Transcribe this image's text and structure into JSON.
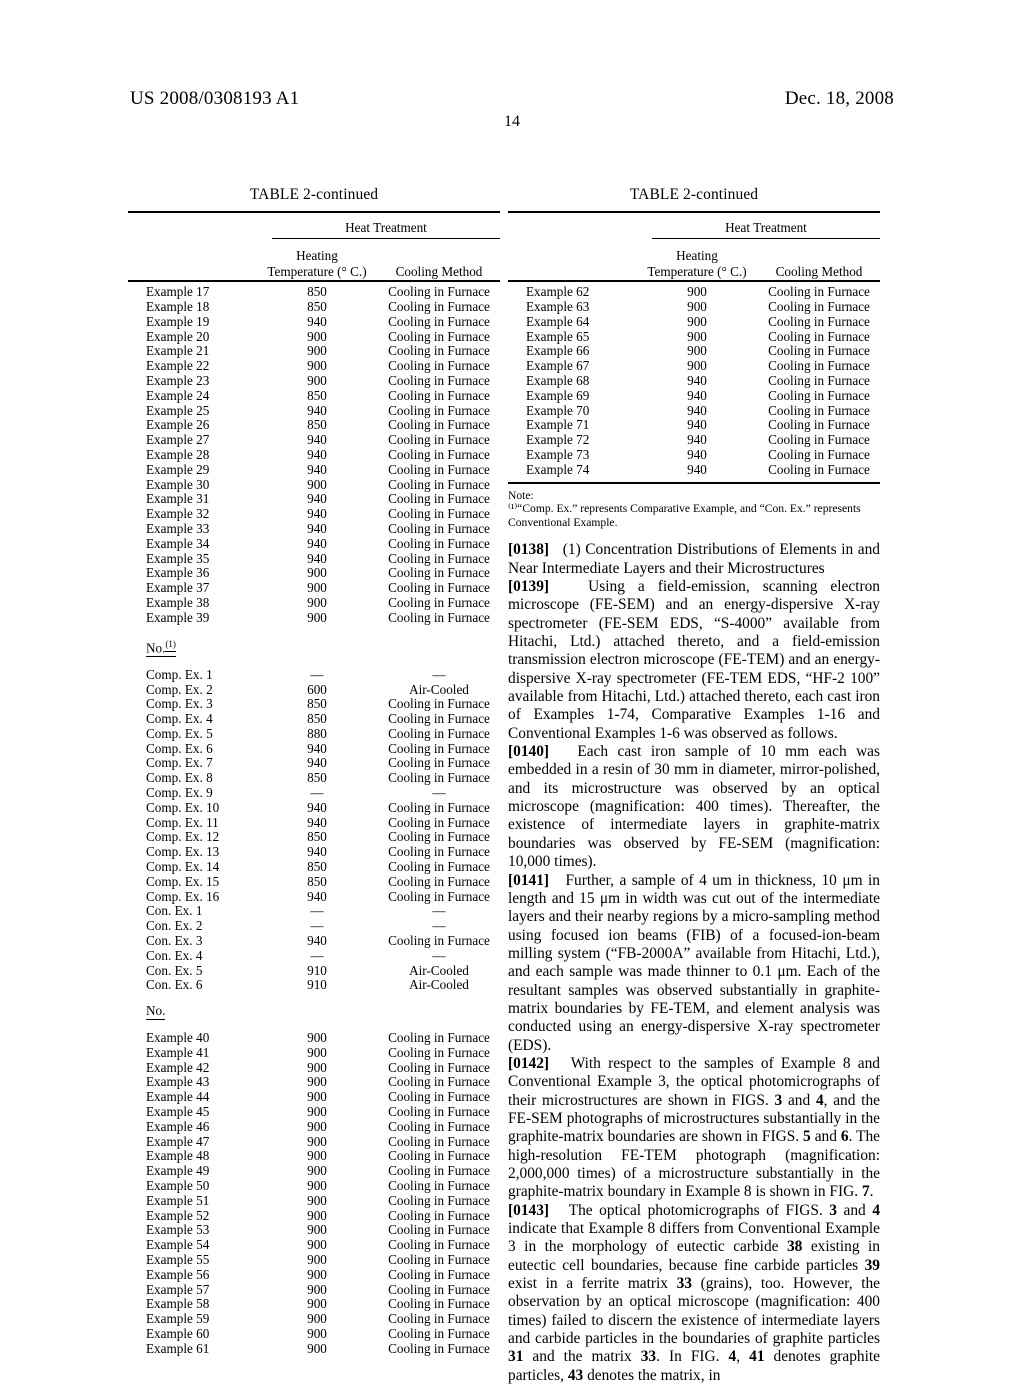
{
  "header": {
    "publication_number": "US 2008/0308193 A1",
    "date": "Dec. 18, 2008",
    "page_number": "14"
  },
  "tables": [
    {
      "title": "TABLE 2-continued",
      "span_header": "Heat Treatment",
      "columns": {
        "name": "",
        "temperature_line1": "Heating",
        "temperature_line2": "Temperature (° C.)",
        "cooling": "Cooling Method"
      },
      "groups": [
        {
          "subheader": null,
          "rows": [
            {
              "name": "Example 17",
              "temperature": "850",
              "cooling": "Cooling in Furnace"
            },
            {
              "name": "Example 18",
              "temperature": "850",
              "cooling": "Cooling in Furnace"
            },
            {
              "name": "Example 19",
              "temperature": "940",
              "cooling": "Cooling in Furnace"
            },
            {
              "name": "Example 20",
              "temperature": "900",
              "cooling": "Cooling in Furnace"
            },
            {
              "name": "Example 21",
              "temperature": "900",
              "cooling": "Cooling in Furnace"
            },
            {
              "name": "Example 22",
              "temperature": "900",
              "cooling": "Cooling in Furnace"
            },
            {
              "name": "Example 23",
              "temperature": "900",
              "cooling": "Cooling in Furnace"
            },
            {
              "name": "Example 24",
              "temperature": "850",
              "cooling": "Cooling in Furnace"
            },
            {
              "name": "Example 25",
              "temperature": "940",
              "cooling": "Cooling in Furnace"
            },
            {
              "name": "Example 26",
              "temperature": "850",
              "cooling": "Cooling in Furnace"
            },
            {
              "name": "Example 27",
              "temperature": "940",
              "cooling": "Cooling in Furnace"
            },
            {
              "name": "Example 28",
              "temperature": "940",
              "cooling": "Cooling in Furnace"
            },
            {
              "name": "Example 29",
              "temperature": "940",
              "cooling": "Cooling in Furnace"
            },
            {
              "name": "Example 30",
              "temperature": "900",
              "cooling": "Cooling in Furnace"
            },
            {
              "name": "Example 31",
              "temperature": "940",
              "cooling": "Cooling in Furnace"
            },
            {
              "name": "Example 32",
              "temperature": "940",
              "cooling": "Cooling in Furnace"
            },
            {
              "name": "Example 33",
              "temperature": "940",
              "cooling": "Cooling in Furnace"
            },
            {
              "name": "Example 34",
              "temperature": "940",
              "cooling": "Cooling in Furnace"
            },
            {
              "name": "Example 35",
              "temperature": "940",
              "cooling": "Cooling in Furnace"
            },
            {
              "name": "Example 36",
              "temperature": "900",
              "cooling": "Cooling in Furnace"
            },
            {
              "name": "Example 37",
              "temperature": "900",
              "cooling": "Cooling in Furnace"
            },
            {
              "name": "Example 38",
              "temperature": "900",
              "cooling": "Cooling in Furnace"
            },
            {
              "name": "Example 39",
              "temperature": "900",
              "cooling": "Cooling in Furnace"
            }
          ]
        },
        {
          "subheader": "No.",
          "subheader_sup": "(1)",
          "rows": [
            {
              "name": "Comp. Ex. 1",
              "temperature": "—",
              "cooling": "—"
            },
            {
              "name": "Comp. Ex. 2",
              "temperature": "600",
              "cooling": "Air-Cooled"
            },
            {
              "name": "Comp. Ex. 3",
              "temperature": "850",
              "cooling": "Cooling in Furnace"
            },
            {
              "name": "Comp. Ex. 4",
              "temperature": "850",
              "cooling": "Cooling in Furnace"
            },
            {
              "name": "Comp. Ex. 5",
              "temperature": "880",
              "cooling": "Cooling in Furnace"
            },
            {
              "name": "Comp. Ex. 6",
              "temperature": "940",
              "cooling": "Cooling in Furnace"
            },
            {
              "name": "Comp. Ex. 7",
              "temperature": "940",
              "cooling": "Cooling in Furnace"
            },
            {
              "name": "Comp. Ex. 8",
              "temperature": "850",
              "cooling": "Cooling in Furnace"
            },
            {
              "name": "Comp. Ex. 9",
              "temperature": "—",
              "cooling": "—"
            },
            {
              "name": "Comp. Ex. 10",
              "temperature": "940",
              "cooling": "Cooling in Furnace"
            },
            {
              "name": "Comp. Ex. 11",
              "temperature": "940",
              "cooling": "Cooling in Furnace"
            },
            {
              "name": "Comp. Ex. 12",
              "temperature": "850",
              "cooling": "Cooling in Furnace"
            },
            {
              "name": "Comp. Ex. 13",
              "temperature": "940",
              "cooling": "Cooling in Furnace"
            },
            {
              "name": "Comp. Ex. 14",
              "temperature": "850",
              "cooling": "Cooling in Furnace"
            },
            {
              "name": "Comp. Ex. 15",
              "temperature": "850",
              "cooling": "Cooling in Furnace"
            },
            {
              "name": "Comp. Ex. 16",
              "temperature": "940",
              "cooling": "Cooling in Furnace"
            },
            {
              "name": "Con. Ex. 1",
              "temperature": "—",
              "cooling": "—"
            },
            {
              "name": "Con. Ex. 2",
              "temperature": "—",
              "cooling": "—"
            },
            {
              "name": "Con. Ex. 3",
              "temperature": "940",
              "cooling": "Cooling in Furnace"
            },
            {
              "name": "Con. Ex. 4",
              "temperature": "—",
              "cooling": "—"
            },
            {
              "name": "Con. Ex. 5",
              "temperature": "910",
              "cooling": "Air-Cooled"
            },
            {
              "name": "Con. Ex. 6",
              "temperature": "910",
              "cooling": "Air-Cooled"
            }
          ]
        },
        {
          "subheader": "No.",
          "subheader_sup": "",
          "rows": [
            {
              "name": "Example 40",
              "temperature": "900",
              "cooling": "Cooling in Furnace"
            },
            {
              "name": "Example 41",
              "temperature": "900",
              "cooling": "Cooling in Furnace"
            },
            {
              "name": "Example 42",
              "temperature": "900",
              "cooling": "Cooling in Furnace"
            },
            {
              "name": "Example 43",
              "temperature": "900",
              "cooling": "Cooling in Furnace"
            },
            {
              "name": "Example 44",
              "temperature": "900",
              "cooling": "Cooling in Furnace"
            },
            {
              "name": "Example 45",
              "temperature": "900",
              "cooling": "Cooling in Furnace"
            },
            {
              "name": "Example 46",
              "temperature": "900",
              "cooling": "Cooling in Furnace"
            },
            {
              "name": "Example 47",
              "temperature": "900",
              "cooling": "Cooling in Furnace"
            },
            {
              "name": "Example 48",
              "temperature": "900",
              "cooling": "Cooling in Furnace"
            },
            {
              "name": "Example 49",
              "temperature": "900",
              "cooling": "Cooling in Furnace"
            },
            {
              "name": "Example 50",
              "temperature": "900",
              "cooling": "Cooling in Furnace"
            },
            {
              "name": "Example 51",
              "temperature": "900",
              "cooling": "Cooling in Furnace"
            },
            {
              "name": "Example 52",
              "temperature": "900",
              "cooling": "Cooling in Furnace"
            },
            {
              "name": "Example 53",
              "temperature": "900",
              "cooling": "Cooling in Furnace"
            },
            {
              "name": "Example 54",
              "temperature": "900",
              "cooling": "Cooling in Furnace"
            },
            {
              "name": "Example 55",
              "temperature": "900",
              "cooling": "Cooling in Furnace"
            },
            {
              "name": "Example 56",
              "temperature": "900",
              "cooling": "Cooling in Furnace"
            },
            {
              "name": "Example 57",
              "temperature": "900",
              "cooling": "Cooling in Furnace"
            },
            {
              "name": "Example 58",
              "temperature": "900",
              "cooling": "Cooling in Furnace"
            },
            {
              "name": "Example 59",
              "temperature": "900",
              "cooling": "Cooling in Furnace"
            },
            {
              "name": "Example 60",
              "temperature": "900",
              "cooling": "Cooling in Furnace"
            },
            {
              "name": "Example 61",
              "temperature": "900",
              "cooling": "Cooling in Furnace"
            }
          ]
        }
      ]
    },
    {
      "title": "TABLE 2-continued",
      "span_header": "Heat Treatment",
      "columns": {
        "name": "",
        "temperature_line1": "Heating",
        "temperature_line2": "Temperature (° C.)",
        "cooling": "Cooling Method"
      },
      "groups": [
        {
          "subheader": null,
          "rows": [
            {
              "name": "Example 62",
              "temperature": "900",
              "cooling": "Cooling in Furnace"
            },
            {
              "name": "Example 63",
              "temperature": "900",
              "cooling": "Cooling in Furnace"
            },
            {
              "name": "Example 64",
              "temperature": "900",
              "cooling": "Cooling in Furnace"
            },
            {
              "name": "Example 65",
              "temperature": "900",
              "cooling": "Cooling in Furnace"
            },
            {
              "name": "Example 66",
              "temperature": "900",
              "cooling": "Cooling in Furnace"
            },
            {
              "name": "Example 67",
              "temperature": "900",
              "cooling": "Cooling in Furnace"
            },
            {
              "name": "Example 68",
              "temperature": "940",
              "cooling": "Cooling in Furnace"
            },
            {
              "name": "Example 69",
              "temperature": "940",
              "cooling": "Cooling in Furnace"
            },
            {
              "name": "Example 70",
              "temperature": "940",
              "cooling": "Cooling in Furnace"
            },
            {
              "name": "Example 71",
              "temperature": "940",
              "cooling": "Cooling in Furnace"
            },
            {
              "name": "Example 72",
              "temperature": "940",
              "cooling": "Cooling in Furnace"
            },
            {
              "name": "Example 73",
              "temperature": "940",
              "cooling": "Cooling in Furnace"
            },
            {
              "name": "Example 74",
              "temperature": "940",
              "cooling": "Cooling in Furnace"
            }
          ]
        }
      ]
    }
  ],
  "note": {
    "label": "Note:",
    "text": "⁽¹⁾“Comp. Ex.” represents Comparative Example, and “Con. Ex.” represents Conventional Example."
  },
  "paragraphs": [
    {
      "number": "[0138]",
      "text": "(1) Concentration Distributions of Elements in and Near Intermediate Layers and their Microstructures"
    },
    {
      "number": "[0139]",
      "text": "Using a field-emission, scanning electron microscope (FE-SEM) and an energy-dispersive X-ray spectrometer (FE-SEM EDS, “S-4000” available from Hitachi, Ltd.) attached thereto, and a field-emission transmission electron microscope (FE-TEM) and an energy-dispersive X-ray spectrometer (FE-TEM EDS, “HF-2 100” available from Hitachi, Ltd.) attached thereto, each cast iron of Examples 1-74, Comparative Examples 1-16 and Conventional Examples 1-6 was observed as follows."
    },
    {
      "number": "[0140]",
      "text": "Each cast iron sample of 10 mm each was embedded in a resin of 30 mm in diameter, mirror-polished, and its microstructure was observed by an optical microscope (magnification: 400 times). Thereafter, the existence of intermediate layers in graphite-matrix boundaries was observed by FE-SEM (magnification: 10,000 times)."
    },
    {
      "number": "[0141]",
      "text": "Further, a sample of 4 um in thickness, 10 μm in length and 15 μm in width was cut out of the intermediate layers and their nearby regions by a micro-sampling method using focused ion beams (FIB) of a focused-ion-beam milling system (“FB-2000A” available from Hitachi, Ltd.), and each sample was made thinner to 0.1 μm. Each of the resultant samples was observed substantially in graphite-matrix boundaries by FE-TEM, and element analysis was conducted using an energy-dispersive X-ray spectrometer (EDS)."
    },
    {
      "number": "[0142]",
      "html": "With respect to the samples of Example 8 and Conventional Example 3, the optical photomicrographs of their microstructures are shown in FIGS. <b>3</b> and <b>4</b>, and the FE-SEM photographs of microstructures substantially in the graphite-matrix boundaries are shown in FIGS. <b>5</b> and <b>6</b>. The high-resolution FE-TEM photograph (magnification: 2,000,000 times) of a microstructure substantially in the graphite-matrix boundary in Example 8 is shown in FIG. <b>7</b>."
    },
    {
      "number": "[0143]",
      "html": "The optical photomicrographs of FIGS. <b>3</b> and <b>4</b> indicate that Example 8 differs from Conventional Example 3 in the morphology of eutectic carbide <b>38</b> existing in eutectic cell boundaries, because fine carbide particles <b>39</b> exist in a ferrite matrix <b>33</b> (grains), too. However, the observation by an optical microscope (magnification: 400 times) failed to discern the existence of intermediate layers and carbide particles in the boundaries of graphite particles <b>31</b> and the matrix <b>33</b>. In FIG. <b>4</b>, <b>41</b> denotes graphite particles, <b>43</b> denotes the matrix, in"
    }
  ]
}
